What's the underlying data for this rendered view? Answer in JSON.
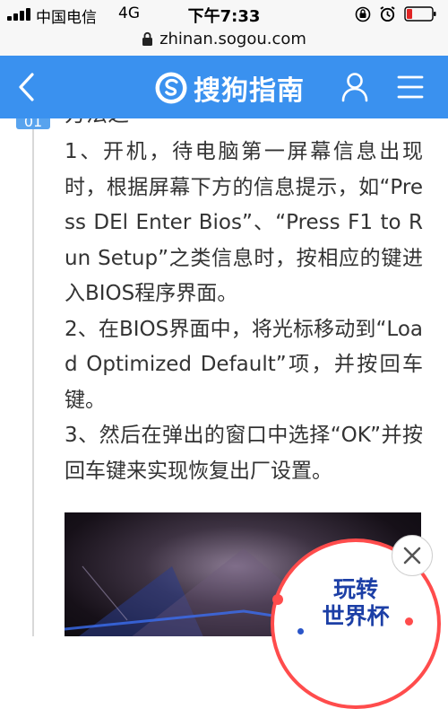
{
  "status_bar": {
    "carrier": "中国电信",
    "network": "4G",
    "time": "下午7:33",
    "icons": [
      "signal-icon",
      "orientation-lock-icon",
      "alarm-icon",
      "battery-icon"
    ]
  },
  "url_bar": {
    "url": "zhinan.sogou.com",
    "icon": "lock-icon"
  },
  "nav_bar": {
    "brand": "搜狗指南",
    "icons": [
      "back-icon",
      "sogou-logo-icon",
      "user-icon",
      "menu-icon"
    ],
    "color": "#3a91ef"
  },
  "article": {
    "step_number": "01",
    "method_heading": "方法之一",
    "steps": [
      "1、开机，待电脑第一屏幕信息出现时，根据屏幕下方的信息提示，如“Press DEl Enter Bios”、“Press F1 to Run Setup”之类信息时，按相应的键进入BIOS程序界面。",
      "2、在BIOS界面中，将光标移动到“Load Optimized Default”项，并按回车键。",
      "3、然后在弹出的窗口中选择“OK”并按回车键来实现恢复出厂设置。"
    ]
  },
  "promo": {
    "line1": "玩转",
    "line2": "世界杯",
    "close_icon": "close-icon",
    "accent": "#ff4c4c"
  }
}
